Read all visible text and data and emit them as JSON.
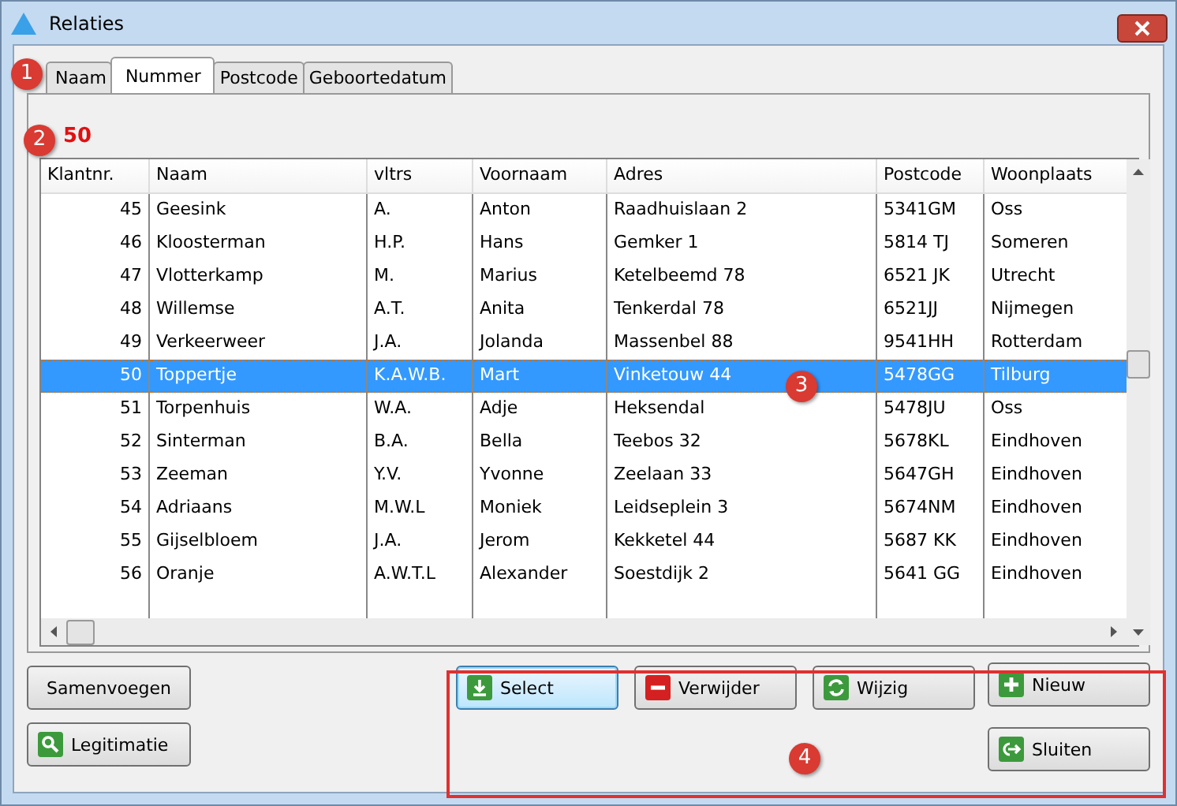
{
  "window": {
    "title": "Relaties"
  },
  "tabs": [
    {
      "label": "Naam",
      "selected": false
    },
    {
      "label": "Nummer",
      "selected": true
    },
    {
      "label": "Postcode",
      "selected": false
    },
    {
      "label": "Geboortedatum",
      "selected": false
    }
  ],
  "search_value": "50",
  "table": {
    "columns": [
      "Klantnr.",
      "Naam",
      "vltrs",
      "Voornaam",
      "Adres",
      "Postcode",
      "Woonplaats"
    ],
    "rows": [
      {
        "selected": false,
        "cells": [
          "45",
          "Geesink",
          "A.",
          "Anton",
          "Raadhuislaan 2",
          "5341GM",
          "Oss"
        ]
      },
      {
        "selected": false,
        "cells": [
          "46",
          "Kloosterman",
          "H.P.",
          "Hans",
          "Gemker 1",
          "5814 TJ",
          "Someren"
        ]
      },
      {
        "selected": false,
        "cells": [
          "47",
          "Vlotterkamp",
          "M.",
          "Marius",
          "Ketelbeemd 78",
          "6521 JK",
          "Utrecht"
        ]
      },
      {
        "selected": false,
        "cells": [
          "48",
          "Willemse",
          "A.T.",
          "Anita",
          "Tenkerdal 78",
          "6521JJ",
          "Nijmegen"
        ]
      },
      {
        "selected": false,
        "cells": [
          "49",
          "Verkeerweer",
          "J.A.",
          "Jolanda",
          "Massenbel 88",
          "9541HH",
          "Rotterdam"
        ]
      },
      {
        "selected": true,
        "cells": [
          "50",
          "Toppertje",
          "K.A.W.B.",
          "Mart",
          "Vinketouw 44",
          "5478GG",
          "Tilburg"
        ]
      },
      {
        "selected": false,
        "cells": [
          "51",
          "Torpenhuis",
          "W.A.",
          "Adje",
          "Heksendal",
          "5478JU",
          "Oss"
        ]
      },
      {
        "selected": false,
        "cells": [
          "52",
          "Sinterman",
          "B.A.",
          "Bella",
          "Teebos 32",
          "5678KL",
          "Eindhoven"
        ]
      },
      {
        "selected": false,
        "cells": [
          "53",
          "Zeeman",
          "Y.V.",
          "Yvonne",
          "Zeelaan 33",
          "5647GH",
          "Eindhoven"
        ]
      },
      {
        "selected": false,
        "cells": [
          "54",
          "Adriaans",
          "M.W.L",
          "Moniek",
          "Leidseplein 3",
          "5674NM",
          "Eindhoven"
        ]
      },
      {
        "selected": false,
        "cells": [
          "55",
          "Gijselbloem",
          "J.A.",
          "Jerom",
          "Kekketel 44",
          "5687 KK",
          "Eindhoven"
        ]
      },
      {
        "selected": false,
        "cells": [
          "56",
          "Oranje",
          "A.W.T.L",
          "Alexander",
          "Soestdijk 2",
          "5641 GG",
          "Eindhoven"
        ]
      }
    ]
  },
  "left_buttons": [
    {
      "label": "Samenvoegen"
    },
    {
      "label": "Legitimatie"
    }
  ],
  "action_buttons": [
    {
      "label": "Select",
      "focused": true
    },
    {
      "label": "Verwijder",
      "focused": false
    },
    {
      "label": "Wijzig",
      "focused": false
    }
  ],
  "side_buttons": [
    {
      "label": "Nieuw",
      "focused": false
    },
    {
      "label": "Sluiten",
      "focused": false
    }
  ],
  "callouts": [
    "1",
    "2",
    "3",
    "4"
  ]
}
